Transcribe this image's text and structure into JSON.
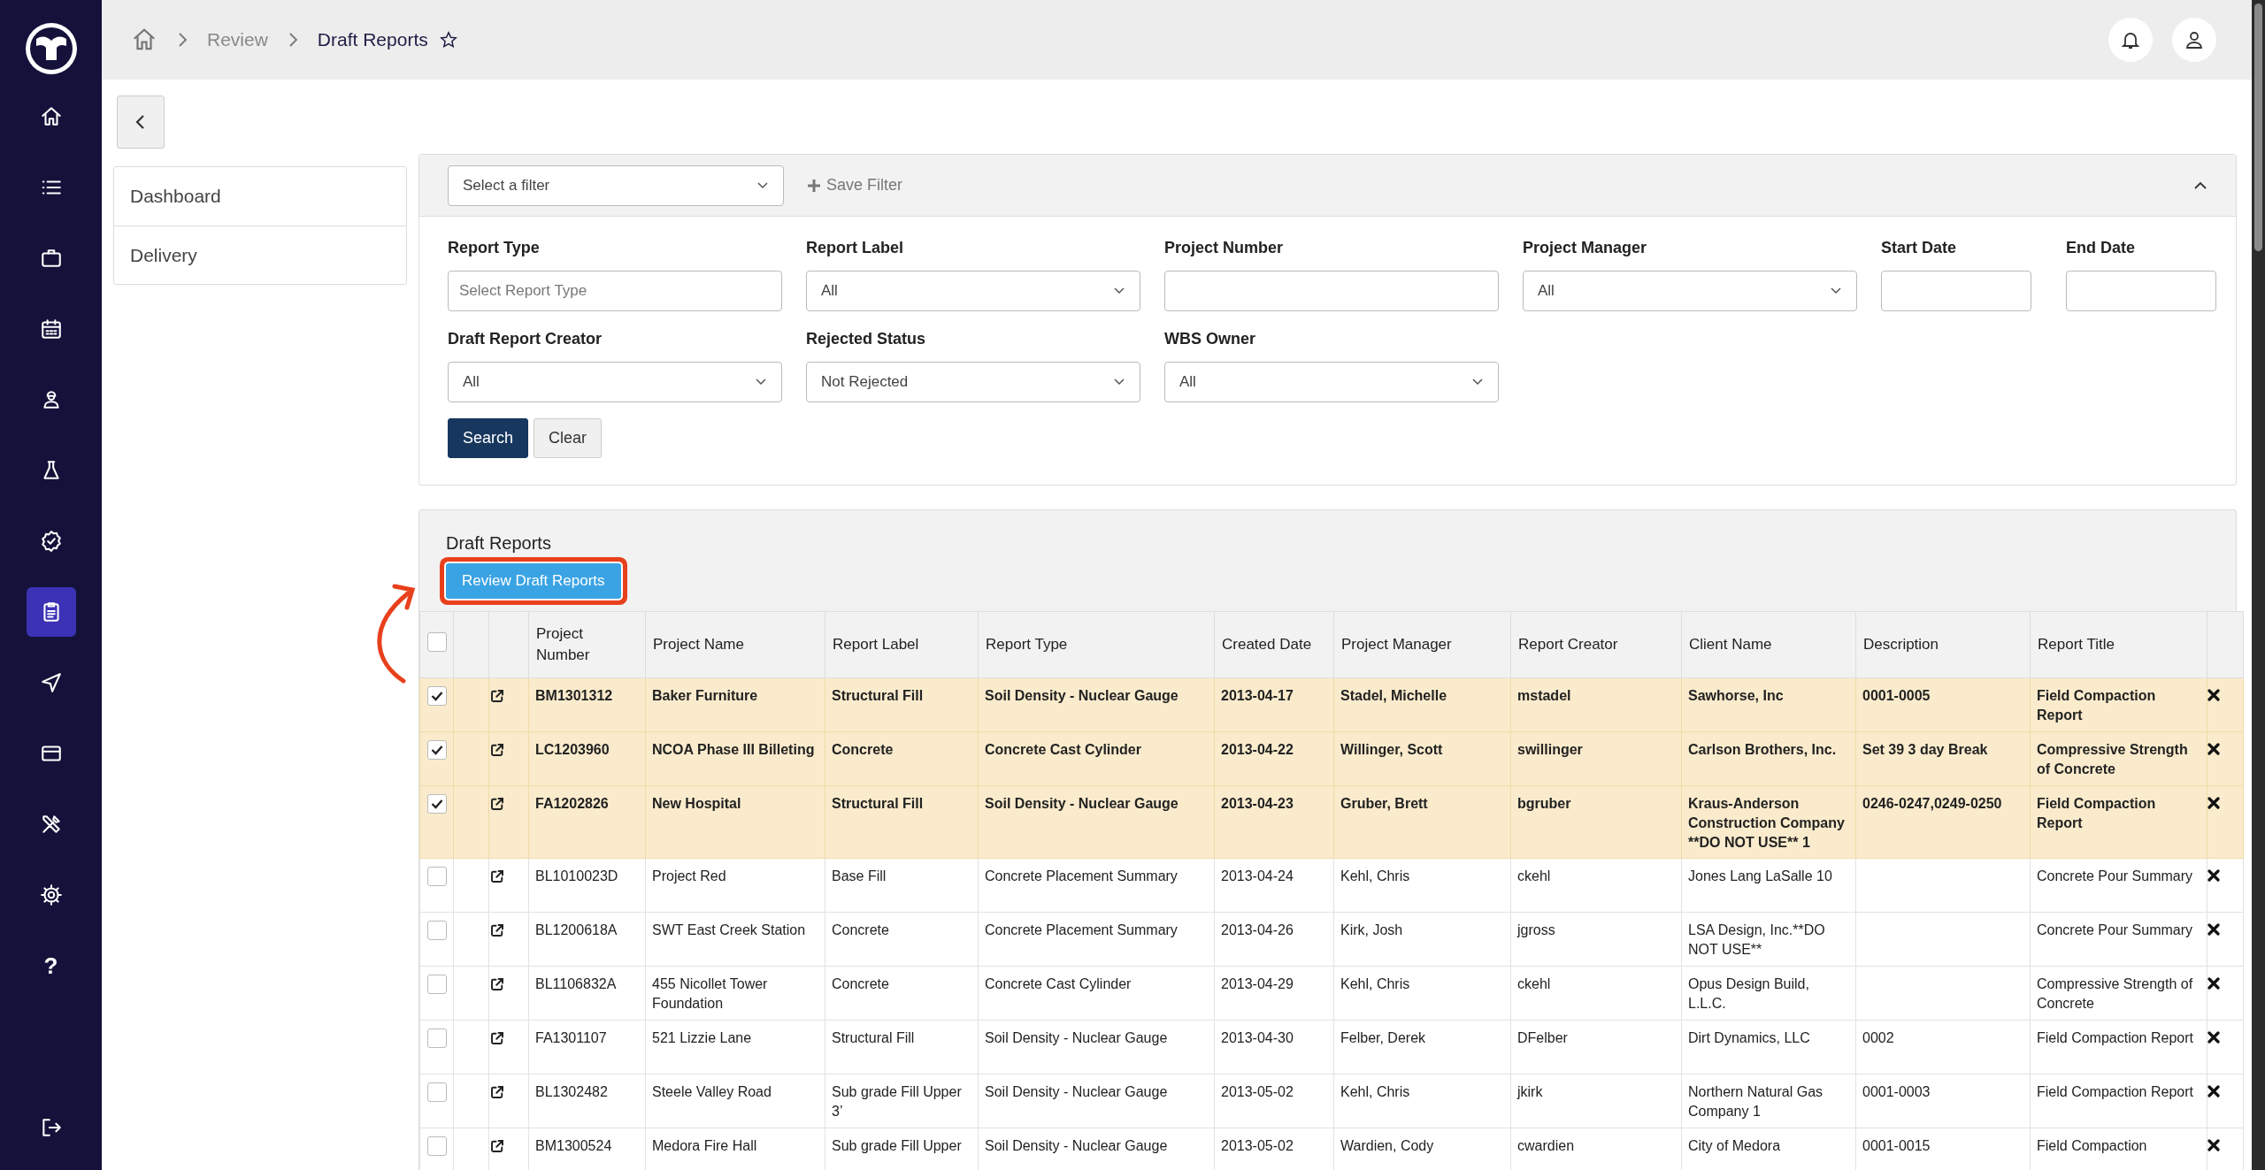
{
  "sidebar": {
    "items": [
      {
        "selected": false
      },
      {
        "selected": false
      },
      {
        "selected": false
      },
      {
        "selected": false
      },
      {
        "selected": false
      },
      {
        "selected": false
      },
      {
        "selected": false
      },
      {
        "selected": true
      },
      {
        "selected": false
      },
      {
        "selected": false
      },
      {
        "selected": false
      },
      {
        "selected": false
      },
      {
        "text": "?",
        "selected": false
      }
    ]
  },
  "breadcrumb": {
    "items": [
      "Review",
      "Draft Reports"
    ],
    "starred": false
  },
  "side_nav": [
    {
      "label": "Dashboard"
    },
    {
      "label": "Delivery"
    }
  ],
  "filter_panel": {
    "saved_filter": {
      "value": "Select a filter"
    },
    "save_button": "Save Filter",
    "expanded": true,
    "rows": [
      [
        {
          "kind": "text",
          "label": "Report Type",
          "placeholder": "Select Report Type"
        },
        {
          "kind": "select",
          "label": "Report Label",
          "value": "All"
        },
        {
          "kind": "text",
          "label": "Project Number"
        },
        {
          "kind": "select",
          "label": "Project Manager",
          "value": "All"
        },
        {
          "kind": "date",
          "label": "Start Date"
        },
        {
          "kind": "date",
          "label": "End Date"
        }
      ],
      [
        {
          "kind": "select",
          "label": "Draft Report Creator",
          "value": "All"
        },
        {
          "kind": "select",
          "label": "Rejected Status",
          "value": "Not Rejected"
        },
        {
          "kind": "select",
          "label": "WBS Owner",
          "value": "All"
        }
      ]
    ],
    "buttons": [
      {
        "label": "Search",
        "kind": "primary"
      },
      {
        "label": "Clear",
        "kind": "secondary"
      }
    ]
  },
  "draft_reports": {
    "title": "Draft Reports",
    "review_button": {
      "label": "Review Draft Reports",
      "highlighted": true
    },
    "select_all_checked": false,
    "columns": [
      "Project Number",
      "Project Name",
      "Report Label",
      "Report Type",
      "Created Date",
      "Project Manager",
      "Report Creator",
      "Client Name",
      "Description",
      "Report Title"
    ],
    "rows": [
      {
        "checked": true,
        "cells": [
          "BM1301312",
          "Baker Furniture",
          "Structural Fill",
          "Soil Density - Nuclear Gauge",
          "2013-04-17",
          "Stadel, Michelle",
          "mstadel",
          "Sawhorse, Inc",
          "0001-0005",
          "Field Compaction Report"
        ]
      },
      {
        "checked": true,
        "cells": [
          "LC1203960",
          "NCOA Phase III Billeting",
          "Concrete",
          "Concrete Cast Cylinder",
          "2013-04-22",
          "Willinger, Scott",
          "swillinger",
          "Carlson Brothers, Inc.",
          "Set 39 3 day Break",
          "Compressive Strength of Concrete"
        ]
      },
      {
        "checked": true,
        "cells": [
          "FA1202826",
          "New Hospital",
          "Structural Fill",
          "Soil Density - Nuclear Gauge",
          "2013-04-23",
          "Gruber, Brett",
          "bgruber",
          "Kraus-Anderson Construction Company **DO NOT USE** 1",
          "0246-0247,0249-0250",
          "Field Compaction Report"
        ]
      },
      {
        "checked": false,
        "cells": [
          "BL1010023D",
          "Project Red",
          "Base Fill",
          "Concrete Placement Summary",
          "2013-04-24",
          "Kehl, Chris",
          "ckehl",
          "Jones Lang LaSalle 10",
          "",
          "Concrete Pour Summary"
        ]
      },
      {
        "checked": false,
        "cells": [
          "BL1200618A",
          "SWT East Creek Station",
          "Concrete",
          "Concrete Placement Summary",
          "2013-04-26",
          "Kirk, Josh",
          "jgross",
          "LSA Design, Inc.**DO NOT USE**",
          "",
          "Concrete Pour Summary"
        ]
      },
      {
        "checked": false,
        "cells": [
          "BL1106832A",
          "455 Nicollet Tower Foundation",
          "Concrete",
          "Concrete Cast Cylinder",
          "2013-04-29",
          "Kehl, Chris",
          "ckehl",
          "Opus Design Build, L.L.C.",
          "",
          "Compressive Strength of Concrete"
        ]
      },
      {
        "checked": false,
        "cells": [
          "FA1301107",
          "521 Lizzie Lane",
          "Structural Fill",
          "Soil Density - Nuclear Gauge",
          "2013-04-30",
          "Felber, Derek",
          "DFelber",
          "Dirt Dynamics, LLC",
          "0002",
          "Field Compaction Report"
        ]
      },
      {
        "checked": false,
        "cells": [
          "BL1302482",
          "Steele Valley Road",
          "Sub grade Fill Upper 3’",
          "Soil Density - Nuclear Gauge",
          "2013-05-02",
          "Kehl, Chris",
          "jkirk",
          "Northern Natural Gas Company 1",
          "0001-0003",
          "Field Compaction Report"
        ]
      },
      {
        "checked": false,
        "cells": [
          "BM1300524",
          "Medora Fire Hall",
          "Sub grade Fill Upper",
          "Soil Density - Nuclear Gauge",
          "2013-05-02",
          "Wardien, Cody",
          "cwardien",
          "City of Medora",
          "0001-0015",
          "Field Compaction"
        ]
      }
    ]
  }
}
